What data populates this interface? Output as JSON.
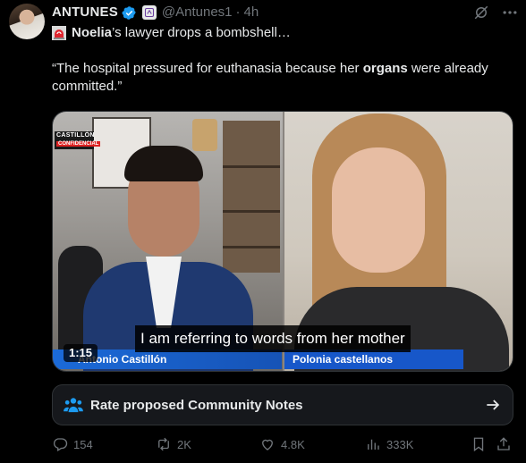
{
  "post": {
    "author_name": "ANTUNES",
    "handle": "@Antunes1",
    "separator": "·",
    "time": "4h",
    "line1_bold": "Noelia",
    "line1_rest": "’s lawyer drops a bombshell…",
    "quote_start": "“The hospital pressured for euthanasia because her ",
    "quote_bold": "organs",
    "quote_end": " were already committed.”"
  },
  "video": {
    "duration": "1:15",
    "subtitle": "I am referring to words from her mother",
    "left_nameplate": "Antonio Castillón",
    "right_nameplate": "Polonia castellanos",
    "logo_line1": "CASTILLÓN",
    "logo_line2": "CONFIDENCIAL"
  },
  "community_notes": {
    "label": "Rate proposed Community Notes"
  },
  "actions": {
    "replies": "154",
    "reposts": "2K",
    "likes": "4.8K",
    "views": "333K"
  },
  "colors": {
    "background": "#000000",
    "text_primary": "#e7e9ea",
    "text_secondary": "#71767b",
    "verified_blue": "#1d9bf0",
    "notes_blue": "#1d9bf0",
    "nameplate_blue": "#1757c9"
  },
  "icons": [
    "verified-icon",
    "grok-icon",
    "more-icon",
    "siren-icon",
    "community-notes-icon",
    "arrow-right-icon",
    "reply-icon",
    "repost-icon",
    "like-icon",
    "views-icon",
    "bookmark-icon",
    "share-icon"
  ]
}
